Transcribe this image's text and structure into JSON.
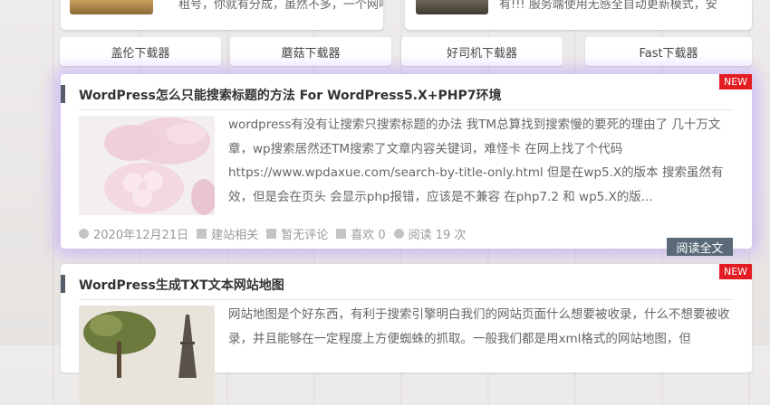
{
  "top_cards": [
    {
      "snippet": "租号，你就有分成，虽然不多，一个网吧的"
    },
    {
      "snippet": "有!!! 服务端使用无感全自动更新模式，安"
    }
  ],
  "nav_buttons": [
    "盖伦下载器",
    "蘑菇下载器",
    "好司机下载器",
    "Fast下载器"
  ],
  "posts": [
    {
      "title": "WordPress怎么只能搜索标题的方法 For WordPress5.X+PHP7环境",
      "badge": "NEW",
      "excerpt": "wordpress有没有让搜索只搜索标题的办法 我TM总算找到搜索慢的要死的理由了 几十万文章，wp搜索居然还TM搜索了文章内容关键词，难怪卡 在网上找了个代码 https://www.wpdaxue.com/search-by-title-only.html 但是在wp5.X的版本 搜索虽然有效，但是会在页头 会显示php报错，应该是不兼容 在php7.2 和 wp5.X的版...",
      "meta": {
        "date": "2020年12月21日",
        "category": "建站相关",
        "comments": "暂无评论",
        "likes": "喜欢 0",
        "views": "阅读 19 次"
      },
      "read_more": "阅读全文"
    },
    {
      "title": "WordPress生成TXT文本网站地图",
      "badge": "NEW",
      "excerpt": "网站地图是个好东西，有利于搜索引擎明白我们的网站页面什么想要被收录，什么不想要被收录，并且能够在一定程度上方便蜘蛛的抓取。一般我们都是用xml格式的网站地图，但"
    }
  ],
  "colors": {
    "badge_red": "#e31b23",
    "read_more_bg": "#5b6a78",
    "title_bar": "#555f6b",
    "glow": "#b496ff"
  }
}
